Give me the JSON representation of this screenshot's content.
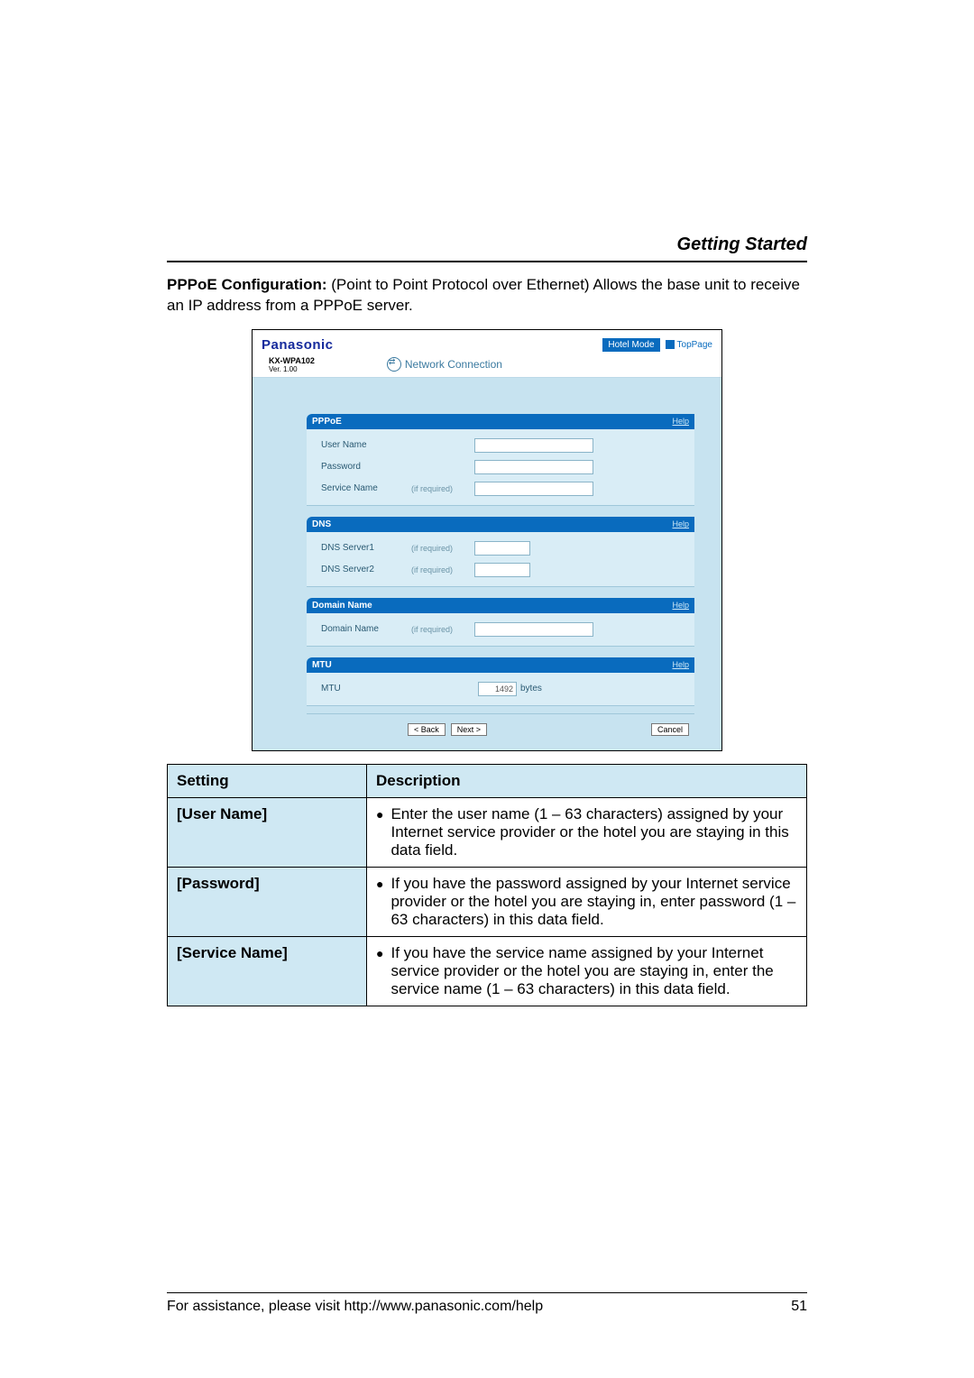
{
  "header": {
    "title": "Getting Started"
  },
  "intro": {
    "lead": "PPPoE Configuration:",
    "text": " (Point to Point Protocol over Ethernet) Allows the base unit to receive an IP address from a PPPoE server."
  },
  "shot": {
    "brand": "Panasonic",
    "hotel_mode": "Hotel Mode",
    "toppage": "TopPage",
    "model": "KX-WPA102",
    "version": "Ver. 1.00",
    "conn_title": "Network Connection",
    "help": "Help",
    "sections": {
      "pppoe": {
        "title": "PPPoE",
        "rows": [
          {
            "label": "User Name",
            "hint": ""
          },
          {
            "label": "Password",
            "hint": ""
          },
          {
            "label": "Service Name",
            "hint": "(if required)"
          }
        ]
      },
      "dns": {
        "title": "DNS",
        "rows": [
          {
            "label": "DNS Server1",
            "hint": "(if required)"
          },
          {
            "label": "DNS Server2",
            "hint": "(if required)"
          }
        ]
      },
      "domain": {
        "title": "Domain Name",
        "rows": [
          {
            "label": "Domain Name",
            "hint": "(if required)"
          }
        ]
      },
      "mtu": {
        "title": "MTU",
        "label": "MTU",
        "value": "1492",
        "unit": "bytes"
      }
    },
    "buttons": {
      "back": "< Back",
      "next": "Next >",
      "cancel": "Cancel"
    }
  },
  "table": {
    "head": {
      "setting": "Setting",
      "desc": "Description"
    },
    "rows": [
      {
        "setting": "[User Name]",
        "desc": "Enter the user name (1 – 63 characters) assigned by your Internet service provider or the hotel you are staying in this data field."
      },
      {
        "setting": "[Password]",
        "desc": "If you have the password assigned by your Internet service provider or the hotel you are staying in, enter password (1 – 63 characters) in this data field."
      },
      {
        "setting": "[Service Name]",
        "desc": "If you have the service name assigned by your Internet service provider or the hotel you are staying in, enter the service name (1 – 63 characters) in this data field."
      }
    ]
  },
  "footer": {
    "assist": "For assistance, please visit http://www.panasonic.com/help",
    "page": "51"
  }
}
